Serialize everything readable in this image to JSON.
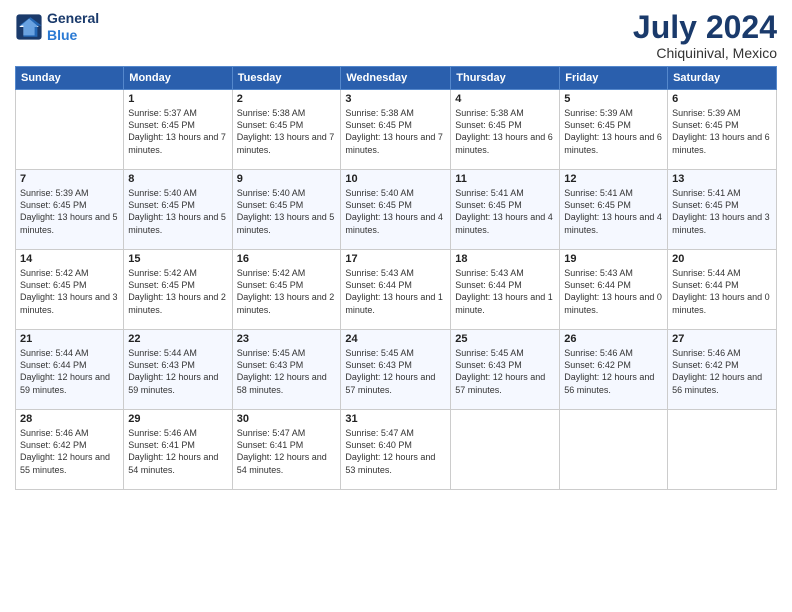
{
  "header": {
    "logo_line1": "General",
    "logo_line2": "Blue",
    "month_year": "July 2024",
    "location": "Chiquinival, Mexico"
  },
  "days_of_week": [
    "Sunday",
    "Monday",
    "Tuesday",
    "Wednesday",
    "Thursday",
    "Friday",
    "Saturday"
  ],
  "weeks": [
    [
      {
        "day": "",
        "sunrise": "",
        "sunset": "",
        "daylight": ""
      },
      {
        "day": "1",
        "sunrise": "Sunrise: 5:37 AM",
        "sunset": "Sunset: 6:45 PM",
        "daylight": "Daylight: 13 hours and 7 minutes."
      },
      {
        "day": "2",
        "sunrise": "Sunrise: 5:38 AM",
        "sunset": "Sunset: 6:45 PM",
        "daylight": "Daylight: 13 hours and 7 minutes."
      },
      {
        "day": "3",
        "sunrise": "Sunrise: 5:38 AM",
        "sunset": "Sunset: 6:45 PM",
        "daylight": "Daylight: 13 hours and 7 minutes."
      },
      {
        "day": "4",
        "sunrise": "Sunrise: 5:38 AM",
        "sunset": "Sunset: 6:45 PM",
        "daylight": "Daylight: 13 hours and 6 minutes."
      },
      {
        "day": "5",
        "sunrise": "Sunrise: 5:39 AM",
        "sunset": "Sunset: 6:45 PM",
        "daylight": "Daylight: 13 hours and 6 minutes."
      },
      {
        "day": "6",
        "sunrise": "Sunrise: 5:39 AM",
        "sunset": "Sunset: 6:45 PM",
        "daylight": "Daylight: 13 hours and 6 minutes."
      }
    ],
    [
      {
        "day": "7",
        "sunrise": "Sunrise: 5:39 AM",
        "sunset": "Sunset: 6:45 PM",
        "daylight": "Daylight: 13 hours and 5 minutes."
      },
      {
        "day": "8",
        "sunrise": "Sunrise: 5:40 AM",
        "sunset": "Sunset: 6:45 PM",
        "daylight": "Daylight: 13 hours and 5 minutes."
      },
      {
        "day": "9",
        "sunrise": "Sunrise: 5:40 AM",
        "sunset": "Sunset: 6:45 PM",
        "daylight": "Daylight: 13 hours and 5 minutes."
      },
      {
        "day": "10",
        "sunrise": "Sunrise: 5:40 AM",
        "sunset": "Sunset: 6:45 PM",
        "daylight": "Daylight: 13 hours and 4 minutes."
      },
      {
        "day": "11",
        "sunrise": "Sunrise: 5:41 AM",
        "sunset": "Sunset: 6:45 PM",
        "daylight": "Daylight: 13 hours and 4 minutes."
      },
      {
        "day": "12",
        "sunrise": "Sunrise: 5:41 AM",
        "sunset": "Sunset: 6:45 PM",
        "daylight": "Daylight: 13 hours and 4 minutes."
      },
      {
        "day": "13",
        "sunrise": "Sunrise: 5:41 AM",
        "sunset": "Sunset: 6:45 PM",
        "daylight": "Daylight: 13 hours and 3 minutes."
      }
    ],
    [
      {
        "day": "14",
        "sunrise": "Sunrise: 5:42 AM",
        "sunset": "Sunset: 6:45 PM",
        "daylight": "Daylight: 13 hours and 3 minutes."
      },
      {
        "day": "15",
        "sunrise": "Sunrise: 5:42 AM",
        "sunset": "Sunset: 6:45 PM",
        "daylight": "Daylight: 13 hours and 2 minutes."
      },
      {
        "day": "16",
        "sunrise": "Sunrise: 5:42 AM",
        "sunset": "Sunset: 6:45 PM",
        "daylight": "Daylight: 13 hours and 2 minutes."
      },
      {
        "day": "17",
        "sunrise": "Sunrise: 5:43 AM",
        "sunset": "Sunset: 6:44 PM",
        "daylight": "Daylight: 13 hours and 1 minute."
      },
      {
        "day": "18",
        "sunrise": "Sunrise: 5:43 AM",
        "sunset": "Sunset: 6:44 PM",
        "daylight": "Daylight: 13 hours and 1 minute."
      },
      {
        "day": "19",
        "sunrise": "Sunrise: 5:43 AM",
        "sunset": "Sunset: 6:44 PM",
        "daylight": "Daylight: 13 hours and 0 minutes."
      },
      {
        "day": "20",
        "sunrise": "Sunrise: 5:44 AM",
        "sunset": "Sunset: 6:44 PM",
        "daylight": "Daylight: 13 hours and 0 minutes."
      }
    ],
    [
      {
        "day": "21",
        "sunrise": "Sunrise: 5:44 AM",
        "sunset": "Sunset: 6:44 PM",
        "daylight": "Daylight: 12 hours and 59 minutes."
      },
      {
        "day": "22",
        "sunrise": "Sunrise: 5:44 AM",
        "sunset": "Sunset: 6:43 PM",
        "daylight": "Daylight: 12 hours and 59 minutes."
      },
      {
        "day": "23",
        "sunrise": "Sunrise: 5:45 AM",
        "sunset": "Sunset: 6:43 PM",
        "daylight": "Daylight: 12 hours and 58 minutes."
      },
      {
        "day": "24",
        "sunrise": "Sunrise: 5:45 AM",
        "sunset": "Sunset: 6:43 PM",
        "daylight": "Daylight: 12 hours and 57 minutes."
      },
      {
        "day": "25",
        "sunrise": "Sunrise: 5:45 AM",
        "sunset": "Sunset: 6:43 PM",
        "daylight": "Daylight: 12 hours and 57 minutes."
      },
      {
        "day": "26",
        "sunrise": "Sunrise: 5:46 AM",
        "sunset": "Sunset: 6:42 PM",
        "daylight": "Daylight: 12 hours and 56 minutes."
      },
      {
        "day": "27",
        "sunrise": "Sunrise: 5:46 AM",
        "sunset": "Sunset: 6:42 PM",
        "daylight": "Daylight: 12 hours and 56 minutes."
      }
    ],
    [
      {
        "day": "28",
        "sunrise": "Sunrise: 5:46 AM",
        "sunset": "Sunset: 6:42 PM",
        "daylight": "Daylight: 12 hours and 55 minutes."
      },
      {
        "day": "29",
        "sunrise": "Sunrise: 5:46 AM",
        "sunset": "Sunset: 6:41 PM",
        "daylight": "Daylight: 12 hours and 54 minutes."
      },
      {
        "day": "30",
        "sunrise": "Sunrise: 5:47 AM",
        "sunset": "Sunset: 6:41 PM",
        "daylight": "Daylight: 12 hours and 54 minutes."
      },
      {
        "day": "31",
        "sunrise": "Sunrise: 5:47 AM",
        "sunset": "Sunset: 6:40 PM",
        "daylight": "Daylight: 12 hours and 53 minutes."
      },
      {
        "day": "",
        "sunrise": "",
        "sunset": "",
        "daylight": ""
      },
      {
        "day": "",
        "sunrise": "",
        "sunset": "",
        "daylight": ""
      },
      {
        "day": "",
        "sunrise": "",
        "sunset": "",
        "daylight": ""
      }
    ]
  ]
}
